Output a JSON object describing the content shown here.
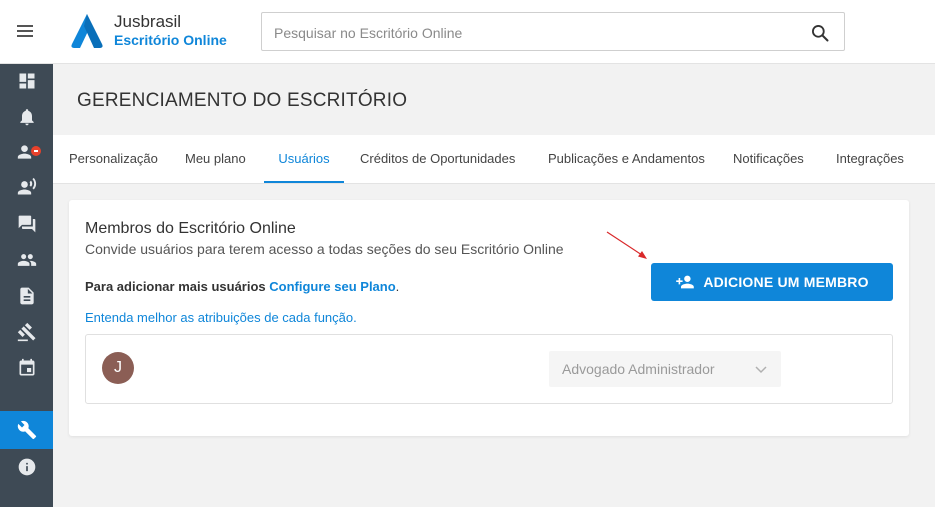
{
  "header": {
    "brand_name": "Jusbrasil",
    "brand_product": "Escritório Online",
    "search_placeholder": "Pesquisar no Escritório Online"
  },
  "sidebar": {
    "items": [
      {
        "icon": "dashboard-icon"
      },
      {
        "icon": "bell-icon"
      },
      {
        "icon": "contacts-icon",
        "badge": true
      },
      {
        "icon": "record-voice-icon"
      },
      {
        "icon": "chat-icon"
      },
      {
        "icon": "people-icon"
      },
      {
        "icon": "document-icon"
      },
      {
        "icon": "gavel-icon"
      },
      {
        "icon": "calendar-icon"
      },
      {
        "icon": "wrench-icon",
        "active": true
      },
      {
        "icon": "info-icon"
      }
    ]
  },
  "page": {
    "title": "GERENCIAMENTO DO ESCRITÓRIO"
  },
  "tabs": [
    {
      "label": "Personalização"
    },
    {
      "label": "Meu plano"
    },
    {
      "label": "Usuários",
      "active": true
    },
    {
      "label": "Créditos de Oportunidades"
    },
    {
      "label": "Publicações e Andamentos"
    },
    {
      "label": "Notificações"
    },
    {
      "label": "Integrações"
    }
  ],
  "members_card": {
    "title": "Membros do Escritório Online",
    "subtitle": "Convide usuários para terem acesso a todas seções do seu Escritório Online",
    "plan_prefix": "Para adicionar mais usuários",
    "plan_link": "Configure seu Plano",
    "plan_suffix": ".",
    "roles_link": "Entenda melhor as atribuições de cada função.",
    "add_button": "ADICIONE UM MEMBRO",
    "members": [
      {
        "initial": "J",
        "role": "Advogado Administrador"
      }
    ]
  },
  "colors": {
    "accent": "#0f86d9",
    "sidebar": "#3e4a55",
    "badge": "#e8412b",
    "annotation_arrow": "#d9282a"
  }
}
